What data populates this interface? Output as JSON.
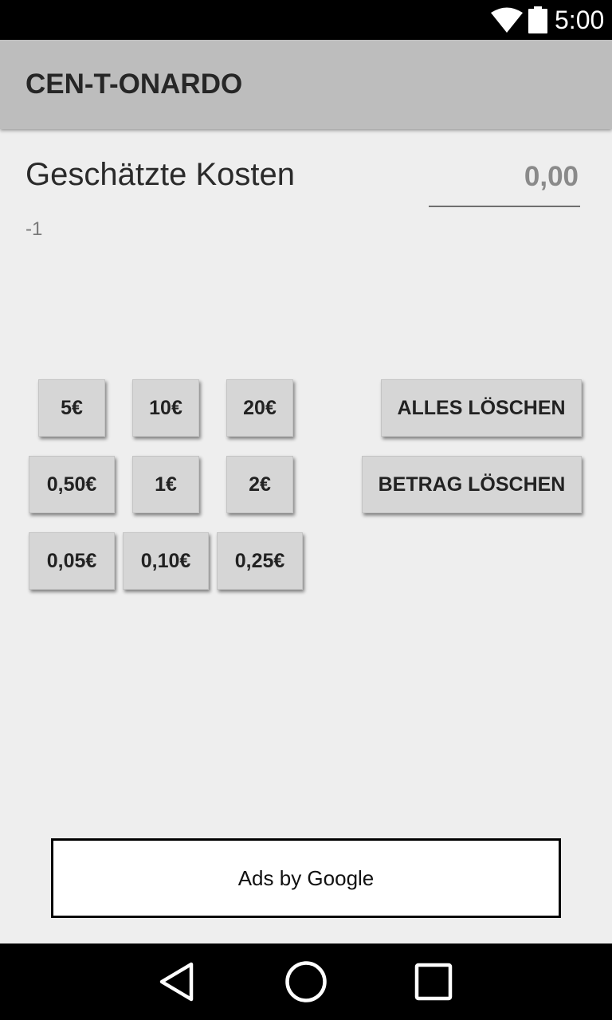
{
  "status_bar": {
    "time": "5:00",
    "icons": [
      "wifi-icon",
      "battery-icon"
    ]
  },
  "app_bar": {
    "title": "CEN-T-ONARDO"
  },
  "main": {
    "cost_label": "Geschätzte Kosten",
    "cost_value": "0,00",
    "sub_value": "-1"
  },
  "buttons": {
    "eur_5": "5€",
    "eur_10": "10€",
    "eur_20": "20€",
    "clear_all": "ALLES LÖSCHEN",
    "eur_050": "0,50€",
    "eur_1": "1€",
    "eur_2": "2€",
    "clear_amount": "BETRAG LÖSCHEN",
    "eur_005": "0,05€",
    "eur_010": "0,10€",
    "eur_025": "0,25€"
  },
  "ad": {
    "label": "Ads by Google"
  },
  "nav_bar": {
    "icons": [
      "back-icon",
      "home-icon",
      "recents-icon"
    ]
  },
  "colors": {
    "app_bar": "#bdbdbd",
    "background": "#eeeeee",
    "button": "#d6d6d6"
  }
}
